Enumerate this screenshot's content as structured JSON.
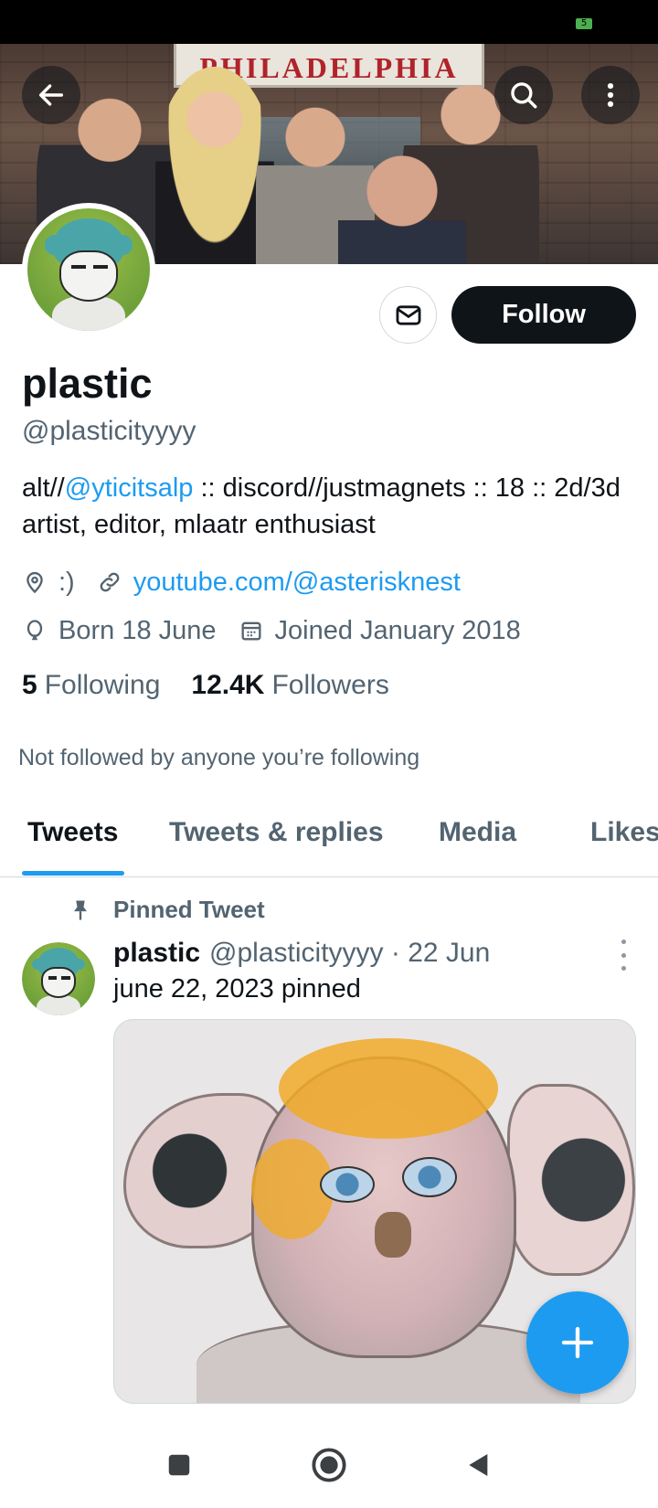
{
  "status_bar": {
    "battery_text": "5"
  },
  "banner": {
    "marquee_text": "PHILADELPHIA"
  },
  "profile": {
    "display_name": "plastic",
    "handle": "@plasticityyyy",
    "bio_prefix": "alt//",
    "bio_mention": "@yticitsalp",
    "bio_suffix": " :: discord//justmagnets :: 18 :: 2d/3d artist, editor, mlaatr enthusiast",
    "location": ":)",
    "website": "youtube.com/@asterisknest",
    "birthday": "Born 18 June",
    "joined": "Joined January 2018",
    "following_count": "5",
    "following_label": "Following",
    "followers_count": "12.4K",
    "followers_label": "Followers",
    "not_followed_text": "Not followed by anyone you’re following"
  },
  "actions": {
    "follow_label": "Follow"
  },
  "tabs": [
    {
      "label": "Tweets",
      "active": true
    },
    {
      "label": "Tweets & replies",
      "active": false
    },
    {
      "label": "Media",
      "active": false
    },
    {
      "label": "Likes",
      "active": false
    }
  ],
  "pinned_tweet": {
    "pinned_label": "Pinned Tweet",
    "author_name": "plastic",
    "author_handle_time": "@plasticityyyy · 22 Jun",
    "text": "june 22, 2023 pinned"
  },
  "colors": {
    "accent": "#1d9bf0",
    "text": "#0f1419",
    "muted": "#536471"
  },
  "icons": [
    "back-arrow-icon",
    "search-icon",
    "more-vertical-icon",
    "mail-icon",
    "location-icon",
    "link-icon",
    "balloon-icon",
    "calendar-icon",
    "pin-icon",
    "more-icon",
    "plus-icon",
    "square-icon",
    "circle-home-icon",
    "triangle-back-icon"
  ]
}
